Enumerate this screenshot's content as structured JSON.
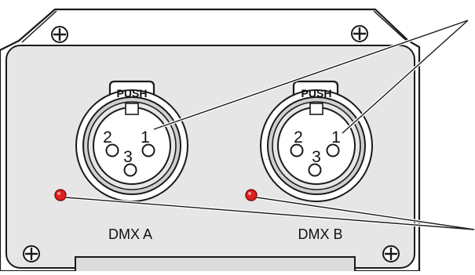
{
  "connectors": [
    {
      "name": "DMX A",
      "push_label": "PUSH",
      "pins": [
        "2",
        "1",
        "3"
      ]
    },
    {
      "name": "DMX B",
      "push_label": "PUSH",
      "pins": [
        "2",
        "1",
        "3"
      ]
    }
  ],
  "colors": {
    "panel": "#ffffff",
    "panel_inner": "#e6e6e6",
    "outline": "#1a1a1a",
    "led": "#e02020",
    "connector_shadow": "#bdbdbd"
  },
  "icons": [
    "screw-icon",
    "led-indicator-icon",
    "xlr-connector-icon"
  ]
}
